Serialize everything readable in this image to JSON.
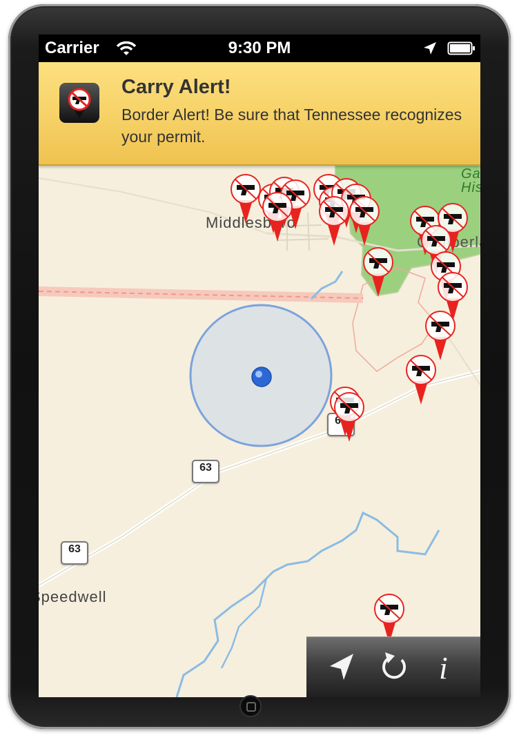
{
  "status_bar": {
    "carrier": "Carrier",
    "time": "9:30 PM"
  },
  "notification": {
    "title": "Carry Alert!",
    "message": "Border Alert! Be sure that Tennessee recognizes your permit."
  },
  "map": {
    "labels": [
      {
        "id": "middlesboro",
        "text": "Middlesboro"
      },
      {
        "id": "cumberland",
        "text": "Cumberland"
      },
      {
        "id": "speedwell",
        "text": "Speedwell"
      },
      {
        "id": "gap-historical",
        "text": "Gap Historical"
      }
    ],
    "route_shields": [
      "63",
      "63",
      "63"
    ]
  },
  "toolbar": {
    "buttons": [
      {
        "id": "locate",
        "icon": "location-arrow-icon"
      },
      {
        "id": "refresh",
        "icon": "refresh-icon"
      },
      {
        "id": "info",
        "label": "i"
      }
    ]
  },
  "colors": {
    "banner": "#f6d166",
    "pin_red": "#e8231f",
    "accuracy_circle": "#7ba3dd",
    "park_green": "#9bd07e",
    "river": "#8bbbe4"
  }
}
